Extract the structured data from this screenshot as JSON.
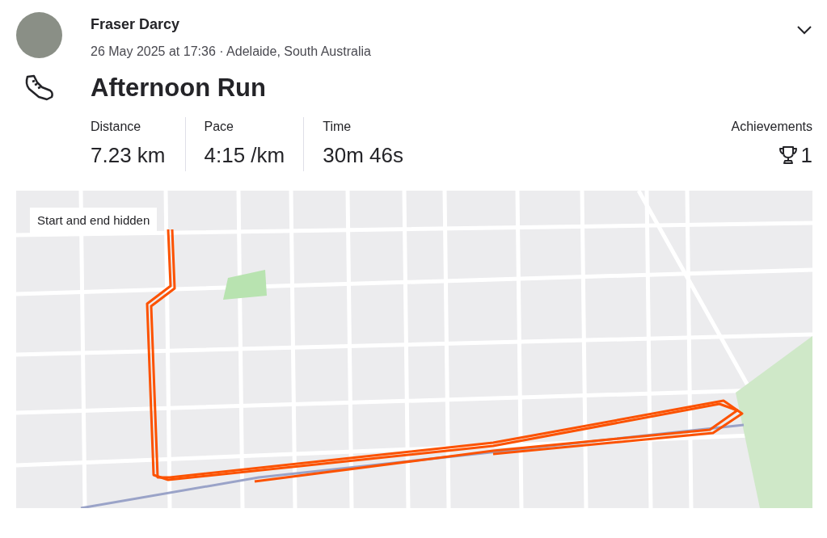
{
  "athlete": {
    "name": "Fraser Darcy",
    "meta": "26 May 2025 at 17:36 · Adelaide, South Australia"
  },
  "activity": {
    "title": "Afternoon Run"
  },
  "stats": [
    {
      "label": "Distance",
      "value": "7.23 km"
    },
    {
      "label": "Pace",
      "value": "4:15 /km"
    },
    {
      "label": "Time",
      "value": "30m 46s"
    }
  ],
  "achievements": {
    "label": "Achievements",
    "value": "1"
  },
  "map": {
    "badge": "Start and end hidden"
  }
}
